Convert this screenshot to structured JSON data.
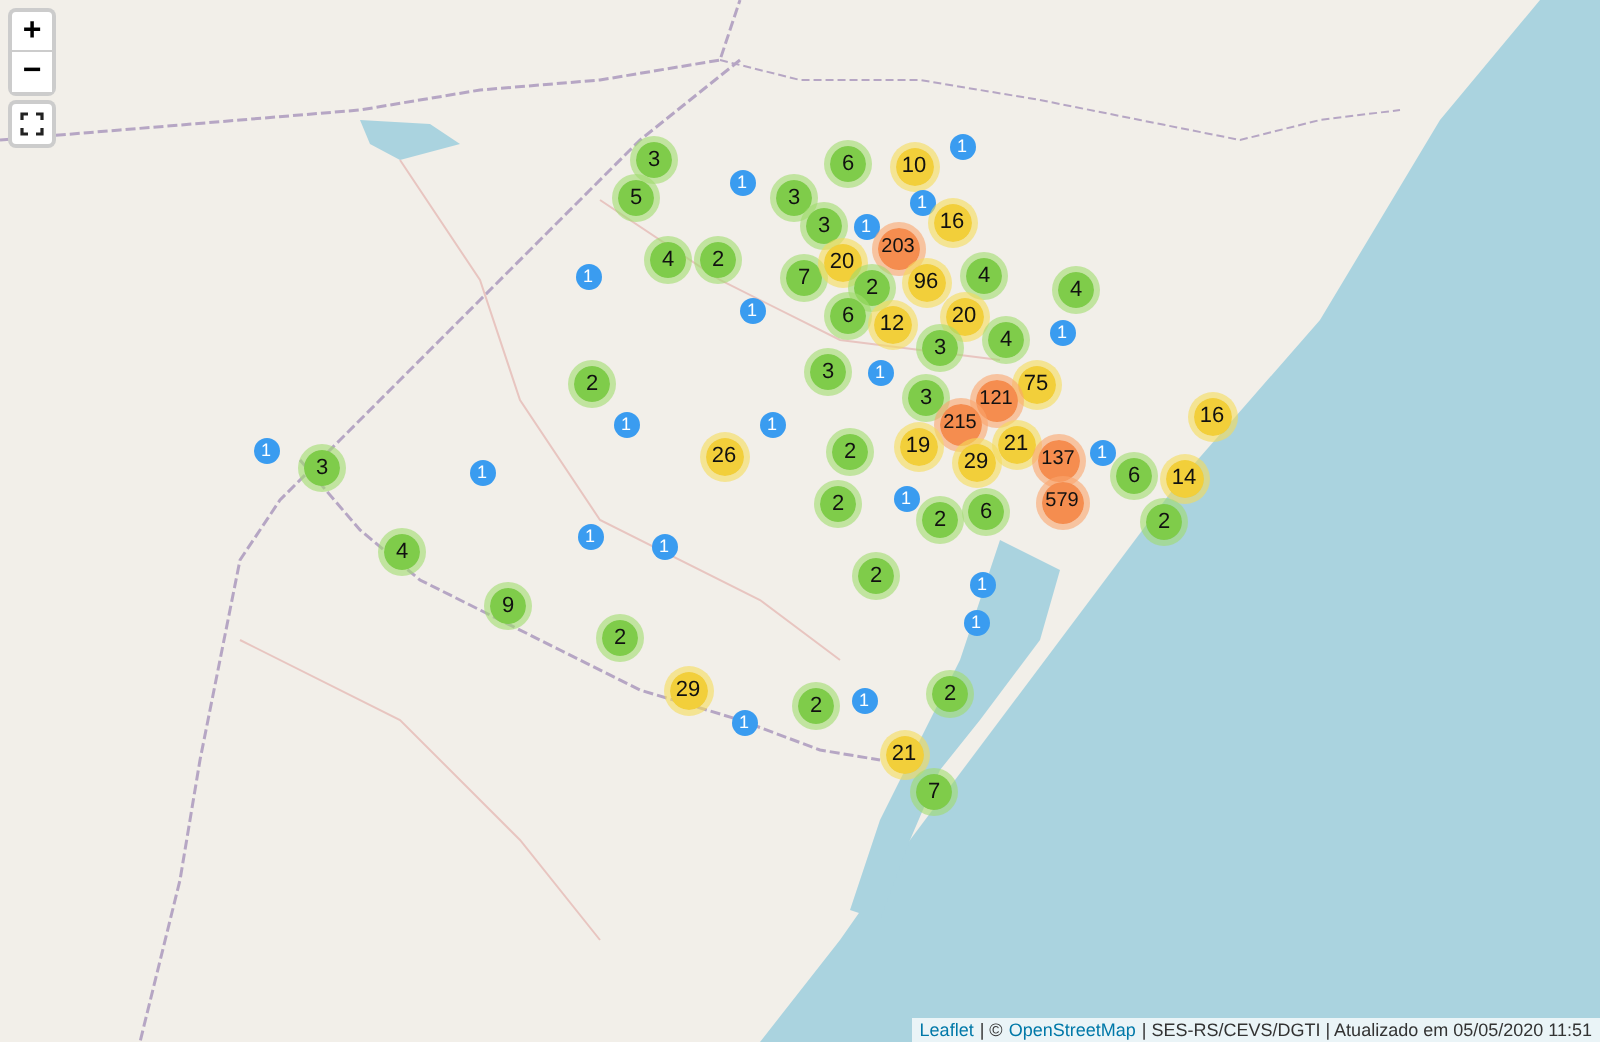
{
  "zoom_controls": {
    "zoom_in": "+",
    "zoom_out": "−"
  },
  "clusters": [
    {
      "count": "3",
      "kind": "small"
    },
    {
      "count": "5",
      "kind": "small"
    },
    {
      "count": "1",
      "kind": "single"
    },
    {
      "count": "6",
      "kind": "small"
    },
    {
      "count": "10",
      "kind": "medium"
    },
    {
      "count": "1",
      "kind": "single"
    },
    {
      "count": "3",
      "kind": "small"
    },
    {
      "count": "3",
      "kind": "small"
    },
    {
      "count": "1",
      "kind": "single"
    },
    {
      "count": "1",
      "kind": "single"
    },
    {
      "count": "16",
      "kind": "medium"
    },
    {
      "count": "203",
      "kind": "large"
    },
    {
      "count": "4",
      "kind": "small"
    },
    {
      "count": "2",
      "kind": "small"
    },
    {
      "count": "1",
      "kind": "single"
    },
    {
      "count": "7",
      "kind": "small"
    },
    {
      "count": "20",
      "kind": "medium"
    },
    {
      "count": "2",
      "kind": "small"
    },
    {
      "count": "96",
      "kind": "medium"
    },
    {
      "count": "4",
      "kind": "small"
    },
    {
      "count": "4",
      "kind": "small"
    },
    {
      "count": "1",
      "kind": "single"
    },
    {
      "count": "6",
      "kind": "small"
    },
    {
      "count": "12",
      "kind": "medium"
    },
    {
      "count": "20",
      "kind": "medium"
    },
    {
      "count": "4",
      "kind": "small"
    },
    {
      "count": "3",
      "kind": "small"
    },
    {
      "count": "1",
      "kind": "single"
    },
    {
      "count": "3",
      "kind": "small"
    },
    {
      "count": "1",
      "kind": "single"
    },
    {
      "count": "2",
      "kind": "small"
    },
    {
      "count": "3",
      "kind": "small"
    },
    {
      "count": "75",
      "kind": "medium"
    },
    {
      "count": "121",
      "kind": "large"
    },
    {
      "count": "1",
      "kind": "single"
    },
    {
      "count": "1",
      "kind": "single"
    },
    {
      "count": "215",
      "kind": "large"
    },
    {
      "count": "16",
      "kind": "medium"
    },
    {
      "count": "1",
      "kind": "single"
    },
    {
      "count": "3",
      "kind": "small"
    },
    {
      "count": "1",
      "kind": "single"
    },
    {
      "count": "26",
      "kind": "medium"
    },
    {
      "count": "2",
      "kind": "small"
    },
    {
      "count": "19",
      "kind": "medium"
    },
    {
      "count": "21",
      "kind": "medium"
    },
    {
      "count": "29",
      "kind": "medium"
    },
    {
      "count": "137",
      "kind": "large"
    },
    {
      "count": "1",
      "kind": "single"
    },
    {
      "count": "6",
      "kind": "small"
    },
    {
      "count": "14",
      "kind": "medium"
    },
    {
      "count": "2",
      "kind": "small"
    },
    {
      "count": "1",
      "kind": "single"
    },
    {
      "count": "579",
      "kind": "large"
    },
    {
      "count": "2",
      "kind": "small"
    },
    {
      "count": "6",
      "kind": "small"
    },
    {
      "count": "2",
      "kind": "small"
    },
    {
      "count": "1",
      "kind": "single"
    },
    {
      "count": "1",
      "kind": "single"
    },
    {
      "count": "4",
      "kind": "small"
    },
    {
      "count": "2",
      "kind": "small"
    },
    {
      "count": "1",
      "kind": "single"
    },
    {
      "count": "9",
      "kind": "small"
    },
    {
      "count": "1",
      "kind": "single"
    },
    {
      "count": "2",
      "kind": "small"
    },
    {
      "count": "29",
      "kind": "medium"
    },
    {
      "count": "1",
      "kind": "single"
    },
    {
      "count": "2",
      "kind": "small"
    },
    {
      "count": "2",
      "kind": "small"
    },
    {
      "count": "1",
      "kind": "single"
    },
    {
      "count": "21",
      "kind": "medium"
    },
    {
      "count": "7",
      "kind": "small"
    }
  ],
  "attribution": [
    {
      "kind": "link",
      "text": "Leaflet"
    },
    {
      "kind": "text",
      "text": "| ©"
    },
    {
      "kind": "link",
      "text": "OpenStreetMap"
    },
    {
      "kind": "text",
      "text": "| SES-RS/CEVS/DGTI | Atualizado em 05/05/2020 11:51"
    }
  ]
}
